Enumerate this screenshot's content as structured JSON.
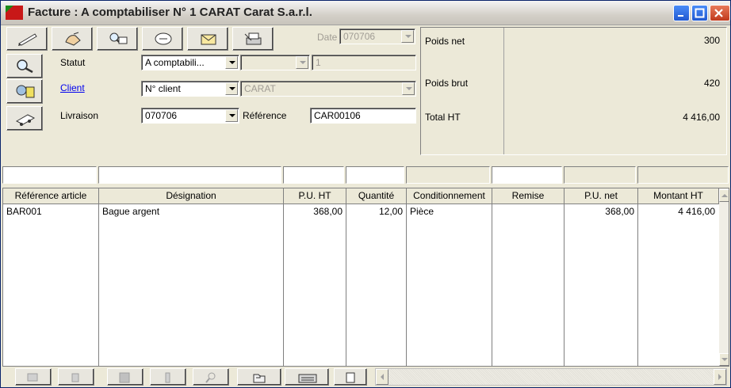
{
  "window": {
    "title": "Facture : A comptabiliser N° 1 CARAT Carat S.a.r.l.",
    "controls": [
      "minimize",
      "maximize",
      "close"
    ]
  },
  "toolbar": {
    "icons": [
      "pencil-edit-icon",
      "hand-writing-icon",
      "magnifier-print-icon",
      "eraser-icon",
      "envelope-icon",
      "printer-signature-icon"
    ],
    "date_label": "Date",
    "date_value": "070706"
  },
  "form": {
    "statut_label": "Statut",
    "statut_value": "A comptabili...",
    "statut_sub_value": "",
    "statut_num": "1",
    "client_label": "Client",
    "client_type_value": "N° client",
    "client_value": "CARAT",
    "livraison_label": "Livraison",
    "livraison_value": "070706",
    "reference_label": "Référence",
    "reference_value": "CAR00106"
  },
  "totals": {
    "poids_net_label": "Poids net",
    "poids_net_value": "300",
    "poids_brut_label": "Poids brut",
    "poids_brut_value": "420",
    "total_ht_label": "Total HT",
    "total_ht_value": "4 416,00"
  },
  "table": {
    "columns": [
      "Référence article",
      "Désignation",
      "P.U. HT",
      "Quantité",
      "Conditionnement",
      "Remise",
      "P.U. net",
      "Montant HT"
    ],
    "rows": [
      {
        "ref": "BAR001",
        "designation": "Bague argent",
        "pu_ht": "368,00",
        "quantite": "12,00",
        "conditionnement": "Pièce",
        "remise": "",
        "pu_net": "368,00",
        "montant_ht": "4 416,00"
      }
    ]
  },
  "bottom_toolbar": {
    "icons": [
      "copy-row-icon",
      "blank-icon",
      "stop-icon",
      "bottle-icon",
      "search-icon",
      "folder-open-icon",
      "keyboard-icon",
      "new-document-icon"
    ]
  },
  "colors": {
    "title_icon": "#cc2020",
    "link": "#0000ee",
    "titlebar_button": "#2058d0",
    "close_button": "#c0391b"
  }
}
